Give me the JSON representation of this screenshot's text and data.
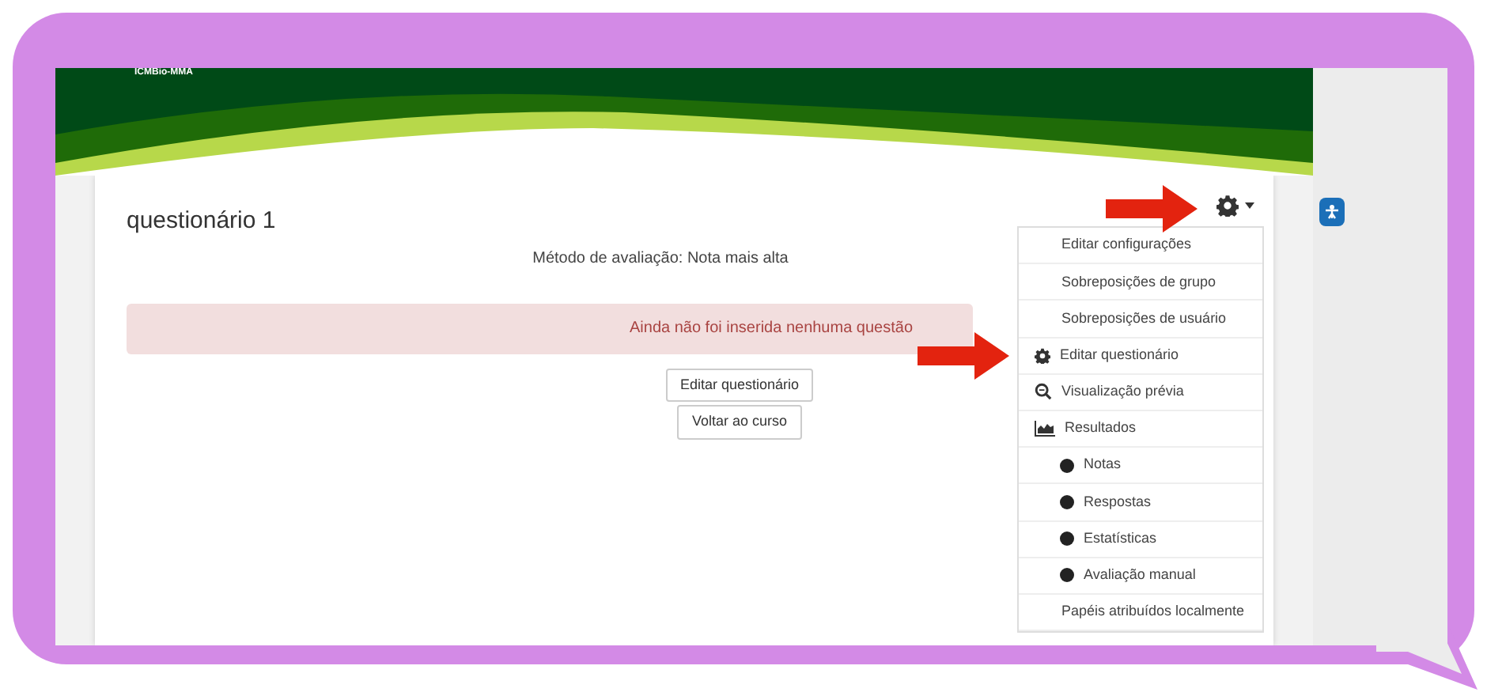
{
  "header": {
    "logo_text": "ICMBio-MMA"
  },
  "quiz": {
    "title": "questionário 1",
    "grading_method": "Método de avaliação: Nota mais alta",
    "alert": "Ainda não foi inserida nenhuma questão",
    "buttons": [
      "Editar questionário",
      "Voltar ao curso"
    ]
  },
  "settings_menu": {
    "items": [
      {
        "label": "Editar configurações",
        "kind": "plain",
        "pointed": false
      },
      {
        "label": "Sobreposições de grupo",
        "kind": "plain",
        "pointed": false
      },
      {
        "label": "Sobreposições de usuário",
        "kind": "plain",
        "pointed": false
      },
      {
        "label": "Editar questionário",
        "kind": "gear",
        "pointed": true
      },
      {
        "label": "Visualização prévia",
        "kind": "preview",
        "pointed": false
      },
      {
        "label": "Resultados",
        "kind": "chart",
        "pointed": false
      },
      {
        "label": "Notas",
        "kind": "bullet",
        "pointed": false
      },
      {
        "label": "Respostas",
        "kind": "bullet",
        "pointed": false
      },
      {
        "label": "Estatísticas",
        "kind": "bullet",
        "pointed": false
      },
      {
        "label": "Avaliação manual",
        "kind": "bullet",
        "pointed": false
      },
      {
        "label": "Papéis atribuídos localmente",
        "kind": "plain",
        "pointed": false
      }
    ]
  }
}
